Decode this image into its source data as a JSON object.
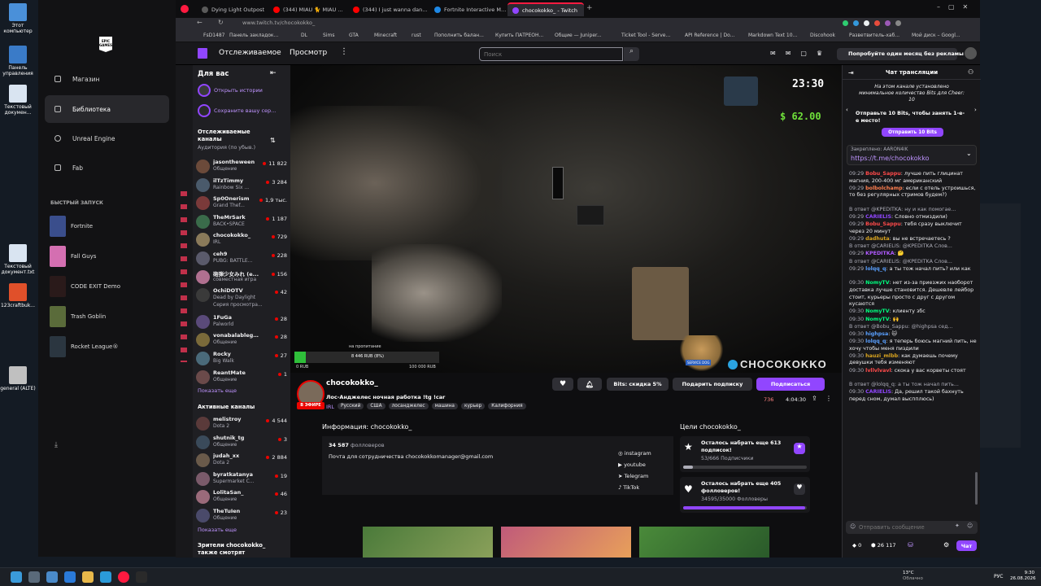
{
  "desktop": {
    "icons": [
      {
        "label": "Этот компьютер"
      },
      {
        "label": "Панель управления"
      },
      {
        "label": "Текстовый докумен..."
      },
      {
        "label": "Текстовый документ.txt"
      },
      {
        "label": "123craftbuk..."
      },
      {
        "label": "general (ALTE)"
      }
    ]
  },
  "epic": {
    "logo": "EPIC GAMES",
    "nav": [
      {
        "label": "Магазин",
        "icon": "tag-icon"
      },
      {
        "label": "Библиотека",
        "icon": "library-icon"
      },
      {
        "label": "Unreal Engine",
        "icon": "unreal-icon"
      },
      {
        "label": "Fab",
        "icon": "fab-icon"
      }
    ],
    "quick_launch_title": "БЫСТРЫЙ ЗАПУСК",
    "quick_launch": [
      {
        "label": "Fortnite",
        "color": "#3a4e8c"
      },
      {
        "label": "Fall Guys",
        "color": "#d46fb1"
      },
      {
        "label": "CODE EXIT Demo",
        "color": "#1a1a1a"
      },
      {
        "label": "Trash Goblin",
        "color": "#5a6b3a"
      },
      {
        "label": "Rocket League®",
        "color": "#2b3640"
      }
    ]
  },
  "browser": {
    "tabs": [
      {
        "title": "Dying Light Outpost",
        "favicon": "#5a5a5a"
      },
      {
        "title": "(344) MIAU 🐈 MIAU 🐈 o",
        "favicon": "#ff0000"
      },
      {
        "title": "(344) I just wanna dance #",
        "favicon": "#ff0000"
      },
      {
        "title": "Fortnite Interactive Map -",
        "favicon": "#1e88e5"
      },
      {
        "title": "chocokokko_ - Twitch",
        "favicon": "#9146ff"
      }
    ],
    "url": "www.twitch.tv/chocokokko_",
    "bookmarks": [
      "FsD1487",
      "Панель закладок...",
      "DL",
      "Sims",
      "GTA",
      "Minecraft",
      "rust",
      "Пополнить балан...",
      "Купить ПАТРЕОН...",
      "Общие — Juniper...",
      "Ticket Tool - Serve...",
      "API Reference | Do...",
      "Markdown Text 10...",
      "Discohook",
      "Разветвитель-хаб...",
      "Мой диск – Googl..."
    ]
  },
  "twitch": {
    "nav": {
      "following": "Отслеживаемое",
      "browse": "Просмотр",
      "search_placeholder": "Поиск",
      "prime": "Попробуйте один месяц без рекламы"
    },
    "sidebar": {
      "for_you": "Для вас",
      "promo1": "Открыть истории",
      "promo2": "Сохраните вашу сер...",
      "followed_title": "Отслеживаемые каналы",
      "followed_sub": "Аудитория (по убыв.)",
      "channels": [
        {
          "name": "jasontheween",
          "game": "Общение",
          "viewers": "11 822",
          "color": "#6b4a3a"
        },
        {
          "name": "ilTzTimmy",
          "game": "Rainbow Six ...",
          "viewers": "3 284",
          "color": "#4a5a6b"
        },
        {
          "name": "Sp0Onerism",
          "game": "Grand Thef...",
          "viewers": "1,9 тыс.",
          "color": "#7a3a3a"
        },
        {
          "name": "TheMrSark",
          "game": "BACK•SPACE",
          "viewers": "1 187",
          "color": "#3a6b4a"
        },
        {
          "name": "chocokokko_",
          "game": "IRL",
          "viewers": "729",
          "color": "#8a7a5a"
        },
        {
          "name": "ceh9",
          "game": "PUBG: BATTLE...",
          "viewers": "228",
          "color": "#5a5a6b"
        },
        {
          "name": "砲弾少女みれ (e...",
          "game": "совместная игра",
          "viewers": "156",
          "color": "#b07090"
        },
        {
          "name": "OchiDOTV",
          "game": "Dead by Daylight",
          "viewers": "42",
          "color": "#3a3a3a",
          "extra": "Серия просмотра..."
        },
        {
          "name": "1FuGa",
          "game": "Palworld",
          "viewers": "28",
          "color": "#5a4a7a"
        },
        {
          "name": "vonabalablege...",
          "game": "Общение",
          "viewers": "28",
          "color": "#7a6a3a"
        },
        {
          "name": "Rocky",
          "game": "Big Walk",
          "viewers": "27",
          "color": "#4a6a7a"
        },
        {
          "name": "ReantMate",
          "game": "Общение",
          "viewers": "1",
          "color": "#6a4a4a"
        }
      ],
      "show_more": "Показать еще",
      "active_title": "Активные каналы",
      "active": [
        {
          "name": "melistroy",
          "game": "Dota 2",
          "viewers": "4 544",
          "color": "#5a3a3a"
        },
        {
          "name": "shutnik_tg",
          "game": "Общение",
          "viewers": "3",
          "color": "#3a4a5a"
        },
        {
          "name": "judah_xx",
          "game": "Dota 2",
          "viewers": "2 884",
          "color": "#6a5a4a"
        },
        {
          "name": "byratkatanya",
          "game": "Supermarket C...",
          "viewers": "19",
          "color": "#7a5a6a"
        },
        {
          "name": "LolitaSan_",
          "game": "Общение",
          "viewers": "46",
          "color": "#9a6a7a"
        },
        {
          "name": "TheTuIen",
          "game": "Общение",
          "viewers": "23",
          "color": "#4a4a6a"
        }
      ],
      "show_more2": "Показать еще",
      "viewers_also": "Зрители chocokokko_ также смотрят"
    },
    "video": {
      "time": "23:30",
      "speed": "$ 62.00",
      "progress_caption": "на пропитание",
      "progress_value": "8 446 RUB (8%)",
      "progress_min": "0 RUB",
      "progress_max": "100 000 RUB",
      "progress_fraction": 0.08,
      "watermark": "CHOCOKOKKO",
      "sticker": "SERVICE DOG"
    },
    "channel": {
      "name": "chocokokko_",
      "title": "Лос-Анджелес ночная работка !tg !car",
      "live": "В ЭФИРЕ",
      "tags": [
        "IRL",
        "Русский",
        "США",
        "лосанджелес",
        "машина",
        "курьер",
        "Калифорния"
      ],
      "bits_btn": "Bits: скидка 5%",
      "gift_btn": "Подарить подписку",
      "sub_btn": "Подписаться",
      "viewers": "736",
      "uptime": "4:04:30"
    },
    "about": {
      "heading": "Информация: chocokokko_",
      "followers": "34 587",
      "followers_label": "фолловеров",
      "contact": "Почта для сотрудничества chocokokkomanager@gmail.com",
      "socials": [
        "instagram",
        "youtube",
        "Telegram",
        "TikTok"
      ]
    },
    "goals": {
      "heading": "Цели chocokokko_",
      "items": [
        {
          "title": "Осталось набрать еще 613 подписок!",
          "sub": "53/666 Подписчики",
          "fraction": 0.08
        },
        {
          "title": "Осталось набрать еще 405 фолловеров!",
          "sub": "34595/35000 Фолловеры",
          "fraction": 0.99
        }
      ]
    },
    "chat": {
      "title": "Чат трансляции",
      "bits_notice": "На этом канале установлено минимальное количество Bits для Cheer: 10",
      "bits_promo": "Отправьте 10 Bits, чтобы занять 1-е-е место!",
      "bits_btn": "Отправить 10 Bits",
      "pinned_label": "Закреплено: AARON4IK",
      "pinned_link": "https://t.me/chocokokko",
      "messages": [
        {
          "time": "09:29",
          "user": "Bobu_Sappu",
          "color": "#ff4a4a",
          "text": "лучше пить глицинат магния, 200-400 мг американский"
        },
        {
          "time": "09:29",
          "user": "bolbolchamp",
          "color": "#ff7f50",
          "text": "если с отель устроишься, то без регулярных стримов будем?)"
        },
        {
          "reply": "В ответ @KPEDITKA: ну и как помогае..."
        },
        {
          "time": "09:29",
          "user": "CARIELIS",
          "color": "#9146ff",
          "text": "Словно отмиздили)"
        },
        {
          "time": "09:29",
          "user": "Bobu_Sappu",
          "color": "#ff4a4a",
          "text": "тебя сразу выключит через 20 минут"
        },
        {
          "time": "09:29",
          "user": "dadhuta",
          "color": "#daa520",
          "text": "вы не встречаетесь ?"
        },
        {
          "reply": "В ответ @CARIELIS: @KPEDITKA Слов..."
        },
        {
          "time": "09:29",
          "user": "KPEDITKA",
          "color": "#b05aff",
          "text": "🤔"
        },
        {
          "reply": "В ответ @CARIELIS: @KPEDITKA Слов..."
        },
        {
          "time": "09:29",
          "user": "lolqq_q",
          "color": "#5aa0ff",
          "text": "а ты тож начал пить? или как"
        },
        {
          "time": "09:30",
          "user": "NomyTV",
          "color": "#00ff7f",
          "text": "нет из-за приезжих наоборот доставка лучше становится. Дешевле лейбор стоит, курьеры просто с друг с другом кусаются"
        },
        {
          "time": "09:30",
          "user": "NomyTV",
          "color": "#00ff7f",
          "text": "клиенту збс"
        },
        {
          "time": "09:30",
          "user": "NomyTV",
          "color": "#00ff7f",
          "text": "🙌"
        },
        {
          "reply": "В ответ @Bobu_Sappu: @highpsa сед..."
        },
        {
          "time": "09:30",
          "user": "highpsa",
          "color": "#5aa0ff",
          "text": "🐱"
        },
        {
          "time": "09:30",
          "user": "lolqq_q",
          "color": "#5aa0ff",
          "text": "я теперь боюсь магний пить, не хочу чтобы меня пиздили"
        },
        {
          "time": "09:30",
          "user": "hauzi_mlbb",
          "color": "#daa520",
          "text": "как думаешь почему девушки тебя изменяют"
        },
        {
          "time": "09:30",
          "user": "lvllvlvavl",
          "color": "#ff4a4a",
          "text": "скока у вас корветы стоят"
        },
        {
          "reply": "В ответ @lolqq_q: а ты тож начал пить..."
        },
        {
          "time": "09:30",
          "user": "CARIELIS",
          "color": "#9146ff",
          "text": "Да, решил такой бахнуть перед сном, думал выспплюсь)"
        }
      ],
      "input_placeholder": "Отправить сообщение",
      "points": "26 117",
      "bits_count": "0",
      "send_btn": "Чат"
    }
  },
  "taskbar": {
    "weather": "13°C",
    "weather_sub": "Облачно",
    "lang": "РУС",
    "time": "9:30",
    "date": "26.08.2026"
  }
}
